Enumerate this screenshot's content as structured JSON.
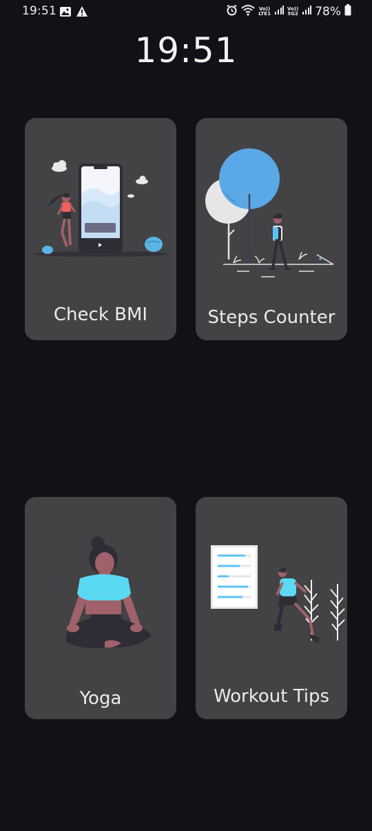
{
  "status_bar": {
    "time": "19:51",
    "battery": "78%",
    "sim1_tag_top": "Vo))",
    "sim1_tag_bottom": "LTE1",
    "sim2_tag_top": "Vo))",
    "sim2_tag_bottom": "5G2",
    "icons": [
      "gallery-icon",
      "warning-icon",
      "alarm-icon",
      "wifi-icon",
      "signal-icon",
      "signal-icon",
      "battery-icon"
    ]
  },
  "clock": {
    "time": "19:51"
  },
  "cards": {
    "bmi": {
      "label": "Check BMI",
      "icon": "bmi-illustration"
    },
    "steps": {
      "label": "Steps Counter",
      "icon": "steps-illustration"
    },
    "yoga": {
      "label": "Yoga",
      "icon": "yoga-illustration"
    },
    "tips": {
      "label": "Workout Tips",
      "icon": "workout-illustration"
    }
  },
  "colors": {
    "background": "#131117",
    "card": "#434244",
    "accent": "#5bc2f5",
    "text": "#ececec"
  }
}
